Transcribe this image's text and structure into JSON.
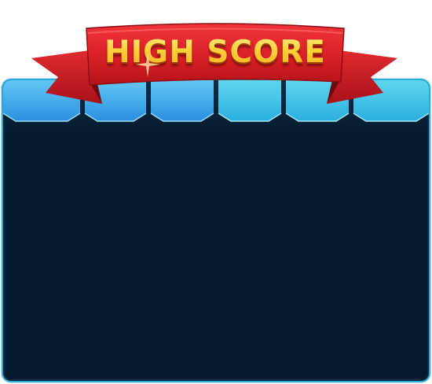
{
  "screen": {
    "title": "HIGH SCORE"
  },
  "tabs": [
    {
      "id": "tab-1",
      "label": ""
    },
    {
      "id": "tab-2",
      "label": ""
    },
    {
      "id": "tab-3",
      "label": ""
    },
    {
      "id": "tab-4",
      "label": ""
    },
    {
      "id": "tab-5",
      "label": ""
    },
    {
      "id": "tab-6",
      "label": ""
    }
  ],
  "colors": {
    "panel_bg": "#011a2e",
    "panel_border": "#2aa9d6",
    "tab_top": "#5cc3f2",
    "tab_bottom": "#2a8fe0",
    "ribbon_red": "#d81f26",
    "ribbon_dark": "#8e0d12",
    "title_gold": "#ffd23a"
  },
  "icons": {
    "sparkle": "sparkle-icon"
  }
}
